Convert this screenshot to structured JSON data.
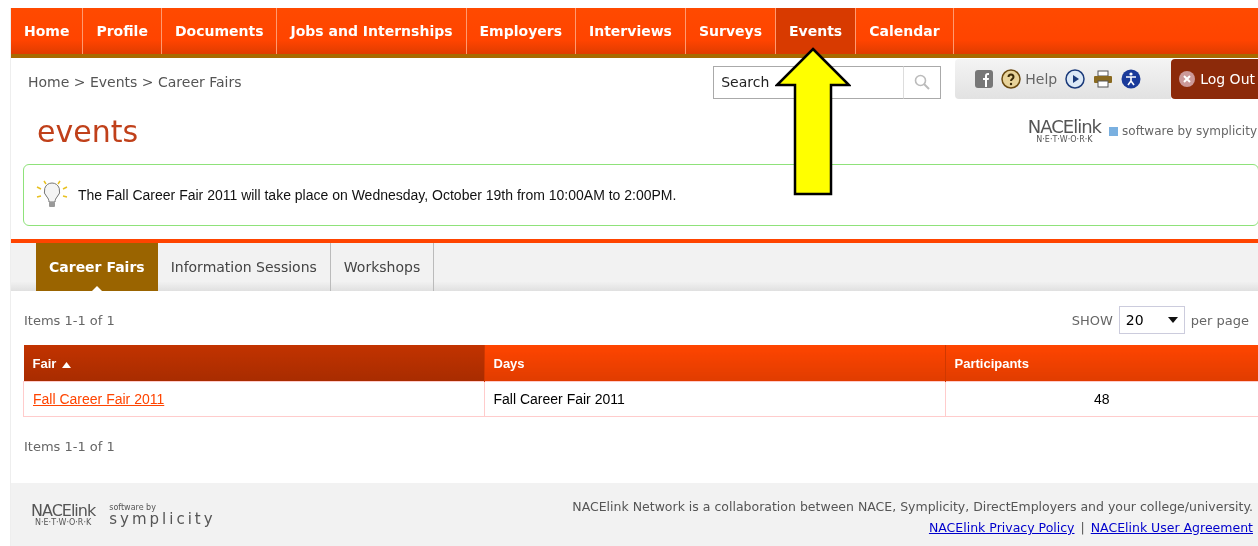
{
  "nav": [
    {
      "label": "Home",
      "selected": false
    },
    {
      "label": "Profile",
      "selected": false
    },
    {
      "label": "Documents",
      "selected": false
    },
    {
      "label": "Jobs and Internships",
      "selected": false
    },
    {
      "label": "Employers",
      "selected": false
    },
    {
      "label": "Interviews",
      "selected": false
    },
    {
      "label": "Surveys",
      "selected": false
    },
    {
      "label": "Events",
      "selected": true
    },
    {
      "label": "Calendar",
      "selected": false
    }
  ],
  "breadcrumb": [
    "Home",
    "Events",
    "Career Fairs"
  ],
  "breadcrumb_separator": ">",
  "search": {
    "placeholder": "Search"
  },
  "toolbar": {
    "help": "Help",
    "logout": "Log Out"
  },
  "page_title": "events",
  "brand": {
    "logo_left": "NACE",
    "logo_right": "link",
    "logo_sub": "N·E·T·W·O·R·K",
    "tagline": "software by symplicity"
  },
  "notice": "The Fall Career Fair 2011 will take place on Wednesday, October 19th from 10:00AM to 2:00PM.",
  "tabs": [
    {
      "label": "Career Fairs",
      "selected": true
    },
    {
      "label": "Information Sessions",
      "selected": false
    },
    {
      "label": "Workshops",
      "selected": false
    }
  ],
  "items_top": "Items 1-1 of 1",
  "show": {
    "label": "SHOW",
    "value": "20",
    "suffix": "per page"
  },
  "table": {
    "columns": [
      {
        "label": "Fair",
        "sorted": true
      },
      {
        "label": "Days",
        "sorted": false
      },
      {
        "label": "Participants",
        "sorted": false
      }
    ],
    "rows": [
      {
        "fair": "Fall Career Fair 2011",
        "days": "Fall Career Fair 2011",
        "participants": "48"
      }
    ]
  },
  "items_bottom": "Items 1-1 of 1",
  "footer": {
    "logo_left": "NACE",
    "logo_right": "link",
    "logo_sub": "N·E·T·W·O·R·K",
    "by": "software by",
    "symplicity": "symplicity",
    "text": "NACElink Network is a collaboration between NACE, Symplicity, DirectEmployers and your college/university.",
    "links": [
      "NACElink Privacy Policy",
      "NACElink User Agreement"
    ],
    "link_separator": "|"
  }
}
